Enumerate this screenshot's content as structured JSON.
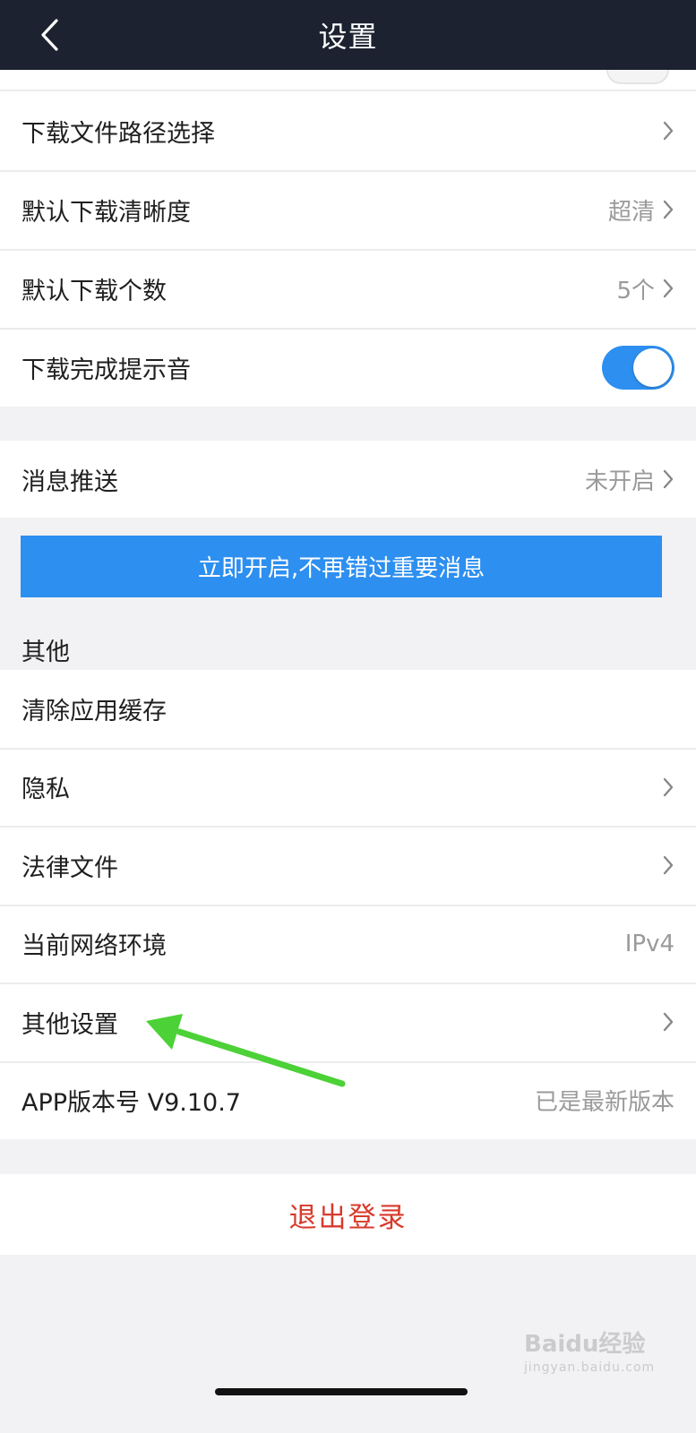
{
  "navbar": {
    "title": "设置"
  },
  "download": {
    "path_label": "下载文件路径选择",
    "quality_label": "默认下载清晰度",
    "quality_value": "超清",
    "count_label": "默认下载个数",
    "count_value": "5个",
    "sound_label": "下载完成提示音"
  },
  "push": {
    "label": "消息推送",
    "value": "未开启",
    "banner": "立即开启,不再错过重要消息"
  },
  "other": {
    "title": "其他",
    "clear_cache": "清除应用缓存",
    "privacy": "隐私",
    "legal": "法律文件",
    "network_label": "当前网络环境",
    "network_value": "IPv4",
    "other_settings": "其他设置",
    "version_label": "APP版本号 V9.10.7",
    "version_value": "已是最新版本"
  },
  "logout": {
    "label": "退出登录"
  },
  "watermark": {
    "main": "Bai​du经验",
    "sub": "jingyan.baidu.com"
  },
  "colors": {
    "accent": "#2d8ff0",
    "logout": "#d83a2b",
    "navbar": "#1d2230",
    "arrow": "#4cd137"
  }
}
